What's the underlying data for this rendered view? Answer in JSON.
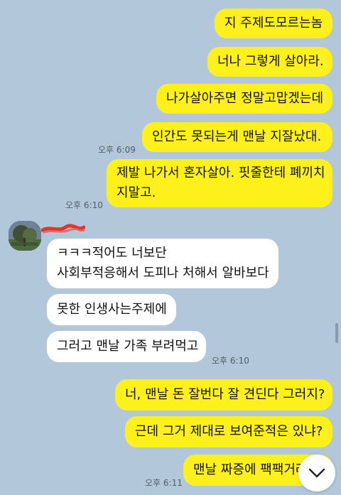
{
  "messages": [
    {
      "text": "지 주제도모르는놈"
    },
    {
      "text": "너나 그렇게 살아라."
    },
    {
      "text": "나가살아주면 정말고맙겠는데"
    },
    {
      "text": "인간도 못되는게 맨날 지잘났대."
    },
    {
      "line1": "제발 나가서 혼자살아. 핏줄한테 폐끼치",
      "line2": "지말고."
    },
    {
      "line1": "ㅋㅋㅋ적어도 너보단",
      "line2": "사회부적응해서 도피나 처해서 알바보다"
    },
    {
      "text": "못한 인생사는주제에"
    },
    {
      "text": "그러고 맨날 가족 부려먹고"
    },
    {
      "text": "너, 맨날 돈 잘번다 잘 견딘다 그러지?"
    },
    {
      "text": "근데 그거 제대로 보여준적은 있냐?"
    },
    {
      "text": "맨날 짜증에 팩팩거려"
    }
  ],
  "times": {
    "t1": "오후 6:09",
    "t2": "오후 6:10",
    "t3": "오후 6:10",
    "t4": "오후 6:11"
  },
  "colors": {
    "background": "#b2c7d9",
    "my_bubble": "#fef01b",
    "other_bubble": "#ffffff"
  },
  "icons": {
    "scroll_down": "chevron-down-icon",
    "avatar": "profile-photo"
  }
}
